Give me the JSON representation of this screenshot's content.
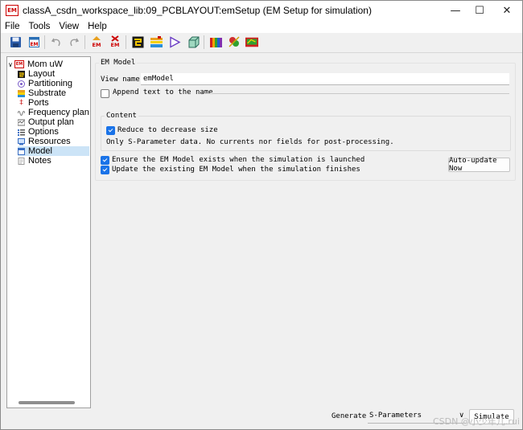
{
  "window": {
    "title": "classA_csdn_workspace_lib:09_PCBLAYOUT:emSetup (EM Setup for simulation)",
    "app_icon_text": "EM",
    "controls": {
      "minimize": "—",
      "maximize": "☐",
      "close": "✕"
    }
  },
  "menu": [
    "File",
    "Tools",
    "View",
    "Help"
  ],
  "toolbar": {
    "items": [
      {
        "name": "save-icon"
      },
      {
        "name": "em-setup-icon",
        "text": "EM"
      },
      {
        "name": "undo-icon"
      },
      {
        "name": "redo-icon"
      },
      {
        "name": "em-run-icon",
        "text": "EM"
      },
      {
        "name": "em-stop-icon",
        "text": "EM"
      },
      {
        "name": "layout-icon"
      },
      {
        "name": "stackup-icon"
      },
      {
        "name": "simulate-play-icon"
      },
      {
        "name": "3d-view-icon"
      },
      {
        "name": "material-library-icon"
      },
      {
        "name": "component-icon"
      },
      {
        "name": "pcb-view-icon"
      }
    ]
  },
  "tree": {
    "root": "Mom uW",
    "items": [
      {
        "label": "Layout",
        "icon": "layout-icon",
        "color": "#1a1a1a"
      },
      {
        "label": "Partitioning",
        "icon": "partitioning-icon",
        "color": "#7a5cc8"
      },
      {
        "label": "Substrate",
        "icon": "substrate-icon",
        "color": "#e0a000"
      },
      {
        "label": "Ports",
        "icon": "ports-icon",
        "color": "#cc2222"
      },
      {
        "label": "Frequency plan",
        "icon": "frequency-plan-icon",
        "color": "#888888"
      },
      {
        "label": "Output plan",
        "icon": "output-plan-icon",
        "color": "#6b6b6b"
      },
      {
        "label": "Options",
        "icon": "options-icon",
        "color": "#3a6fc4"
      },
      {
        "label": "Resources",
        "icon": "resources-icon",
        "color": "#3a6fc4"
      },
      {
        "label": "Model",
        "icon": "model-icon",
        "color": "#3a6fc4",
        "selected": true
      },
      {
        "label": "Notes",
        "icon": "notes-icon",
        "color": "#9a9a9a"
      }
    ]
  },
  "panel": {
    "group_title": "EM Model",
    "view_name_label": "View name:",
    "view_name_value": "emModel",
    "append_label": "Append text to the name",
    "append_checked": false,
    "content_title": "Content",
    "reduce_label": "Reduce to decrease size",
    "reduce_checked": true,
    "content_note": "Only S-Parameter data. No currents nor fields for post-processing.",
    "ensure_label": "Ensure the EM Model exists when the simulation is launched",
    "ensure_checked": true,
    "update_label": "Update the existing EM Model when the simulation finishes",
    "update_checked": true,
    "auto_update_button": "Auto-update Now"
  },
  "footer": {
    "generate_label": "Generate:",
    "generate_value": "S-Parameters",
    "simulate_button": "Simulate"
  },
  "watermark": "CSDN @小少年儿.rui"
}
